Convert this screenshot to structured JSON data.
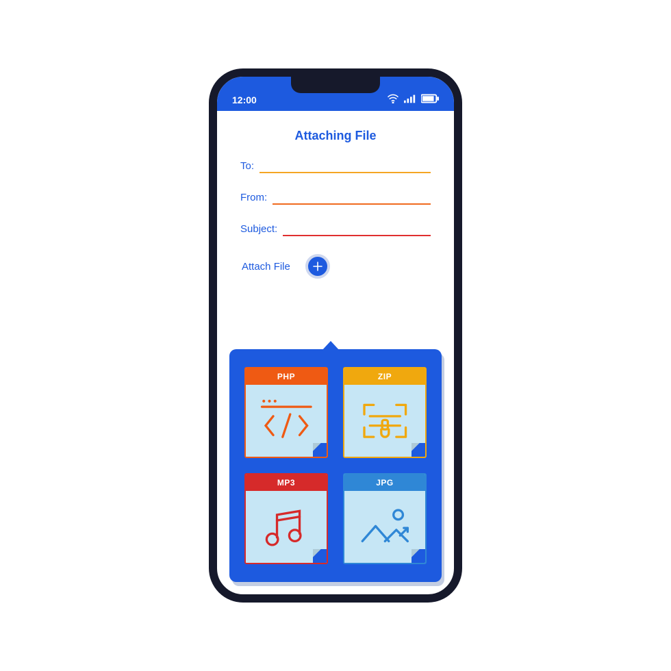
{
  "status": {
    "time": "12:00"
  },
  "title": "Attaching File",
  "form": {
    "to_label": "To:",
    "from_label": "From:",
    "subject_label": "Subject:",
    "to_value": "",
    "from_value": "",
    "subject_value": ""
  },
  "attach": {
    "label": "Attach File"
  },
  "files": {
    "php": {
      "label": "PHP"
    },
    "zip": {
      "label": "ZIP"
    },
    "mp3": {
      "label": "MP3"
    },
    "jpg": {
      "label": "JPG"
    }
  },
  "colors": {
    "primary": "#1d5adf",
    "amber": "#f5a623",
    "orange": "#f06a1f",
    "red": "#e02f2f",
    "file_body": "#c6e6f5"
  }
}
